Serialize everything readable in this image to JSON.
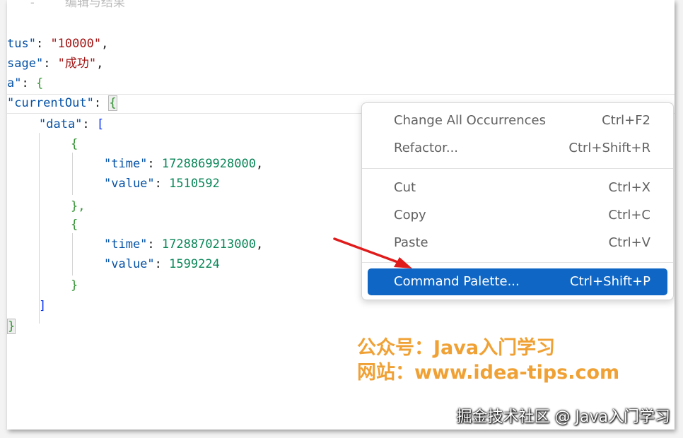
{
  "editor": {
    "top_fragment": "   ‐    编辑与结果",
    "lines": {
      "status_key": "tus\"",
      "status_value": "\"10000\"",
      "message_key": "sage\"",
      "message_value": "\"成功\"",
      "data_key": "a\"",
      "open_brace": "{",
      "current_key": "\"currentOut\"",
      "data_inner_key": "\"data\"",
      "open_bracket": "[",
      "time_key": "\"time\"",
      "value_key": "\"value\"",
      "time_1": "1728869928000",
      "value_1": "1510592",
      "time_2": "1728870213000",
      "value_2": "1599224",
      "close_obj_comma": "},",
      "close_obj": "}",
      "close_bracket": "]",
      "close_brace": "}",
      "colon": ": ",
      "comma": ","
    }
  },
  "context_menu": {
    "groups": [
      [
        {
          "label": "Change All Occurrences",
          "shortcut": "Ctrl+F2"
        },
        {
          "label": "Refactor...",
          "shortcut": "Ctrl+Shift+R"
        }
      ],
      [
        {
          "label": "Cut",
          "shortcut": "Ctrl+X"
        },
        {
          "label": "Copy",
          "shortcut": "Ctrl+C"
        },
        {
          "label": "Paste",
          "shortcut": "Ctrl+V"
        }
      ],
      [
        {
          "label": "Command Palette...",
          "shortcut": "Ctrl+Shift+P",
          "active": true
        }
      ]
    ],
    "active_color": "#0f66c4"
  },
  "watermark": {
    "line1": "公众号：Java入门学习",
    "line2": "网站：www.idea-tips.com",
    "color": "#f0a135"
  },
  "footer": {
    "text": "掘金技术社区 @ Java入门学习"
  },
  "arrow_icon": "red-arrow-icon"
}
